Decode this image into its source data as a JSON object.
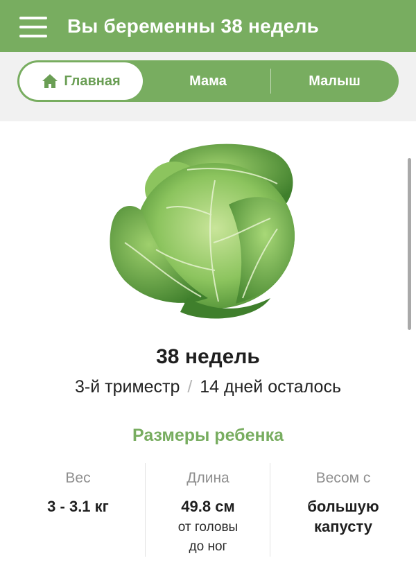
{
  "header": {
    "title": "Вы беременны 38 недель",
    "menu_icon": "hamburger-menu-icon"
  },
  "tabs": [
    {
      "label": "Главная",
      "icon": "home-icon",
      "active": true
    },
    {
      "label": "Мама",
      "active": false
    },
    {
      "label": "Малыш",
      "active": false
    }
  ],
  "hero": {
    "image": "cabbage-illustration",
    "week": "38 недель",
    "trimester": "3-й триместр",
    "separator": "/",
    "days_left": "14 дней осталось"
  },
  "sizes": {
    "title": "Размеры ребенка",
    "weight": {
      "label": "Вес",
      "value": "3 - 3.1 кг"
    },
    "length": {
      "label": "Длина",
      "value": "49.8 см",
      "note_line1": "от головы",
      "note_line2": "до ног"
    },
    "compare": {
      "label": "Весом с",
      "value_line1": "большую",
      "value_line2": "капусту"
    }
  },
  "colors": {
    "brand_green": "#78ad60",
    "tab_background": "#f1f1f1"
  }
}
